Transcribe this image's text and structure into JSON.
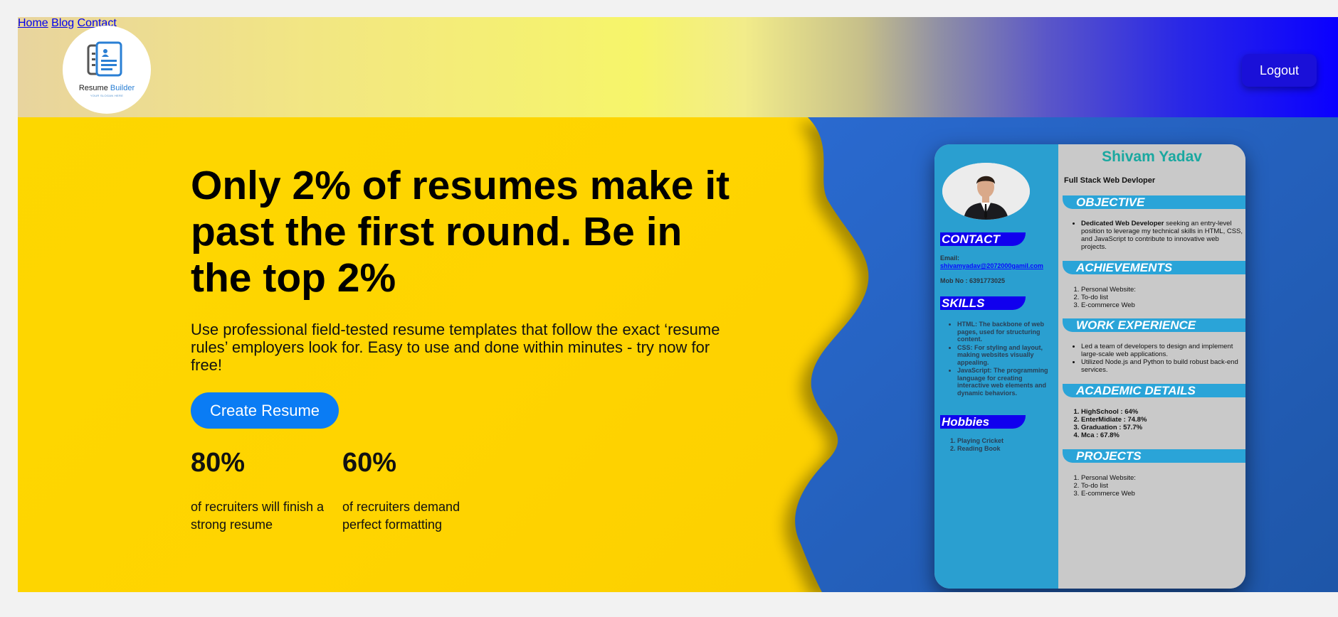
{
  "brand": {
    "name_part1": "Resume",
    "name_part2": "Builder",
    "tagline": "YOUR SLOGAN HERE",
    "colors": {
      "primary": "#2a7fd4",
      "dark": "#4a4a4a"
    }
  },
  "nav": {
    "items": [
      "Home",
      "Blog",
      "Contact"
    ],
    "logout_label": "Logout",
    "logout_color": "#1a10d8"
  },
  "hero": {
    "headline": "Only 2% of resumes make it past the first round. Be in the top 2%",
    "subtext": "Use professional field-tested resume templates that follow the exact ‘resume rules’ employers look for. Easy to use and done within minutes - try now for free!",
    "cta_label": "Create Resume",
    "cta_color": "#0a7cf4",
    "stats": [
      {
        "value": "80%",
        "text": "of recruiters will finish a strong resume"
      },
      {
        "value": "60%",
        "text": "of recruiters demand perfect formatting"
      }
    ]
  },
  "resume": {
    "name": "Shivam Yadav",
    "role": "Full Stack Web Devloper",
    "contact": {
      "heading": "CONTACT",
      "email_label": "Email:",
      "email": "shivamyadav@2072000gamil.com",
      "mobile": "Mob No : 6391773025"
    },
    "skills": {
      "heading": "SKILLS",
      "items": [
        "HTML: The backbone of web pages, used for structuring content.",
        "CSS: For styling and layout, making websites visually appealing.",
        "JavaScript: The programming language for creating interactive web elements and dynamic behaviors."
      ]
    },
    "hobbies": {
      "heading": "Hobbies",
      "items": [
        "Playing Cricket",
        "Reading Book"
      ]
    },
    "objective": {
      "heading": "OBJECTIVE",
      "bold": "Dedicated Web Developer",
      "text": " seeking an entry-level position to leverage my technical skills in HTML, CSS, and JavaScript to contribute to innovative web projects."
    },
    "achievements": {
      "heading": "ACHIEVEMENTS",
      "items": [
        "Personal Website:",
        "To-do list",
        "E-commerce Web"
      ]
    },
    "work": {
      "heading": "WORK EXPERIENCE",
      "items": [
        "Led a team of developers to design and implement large-scale web applications.",
        "Utilized Node.js and Python to build robust back-end services."
      ]
    },
    "academic": {
      "heading": "ACADEMIC DETAILS",
      "items": [
        "HighSchool : 64%",
        "EnterMidiate : 74.8%",
        "Graduation :  57.7%",
        "Mca    : 67.8%"
      ]
    },
    "projects": {
      "heading": "PROJECTS",
      "items": [
        "Personal Website:",
        "To-do list",
        "E-commerce Web"
      ]
    },
    "colors": {
      "sidebar": "#2a9fd0",
      "heading_bg_left": "#1100ee",
      "heading_bg_right": "#2aa4d8",
      "name": "#1aa8a0"
    }
  }
}
